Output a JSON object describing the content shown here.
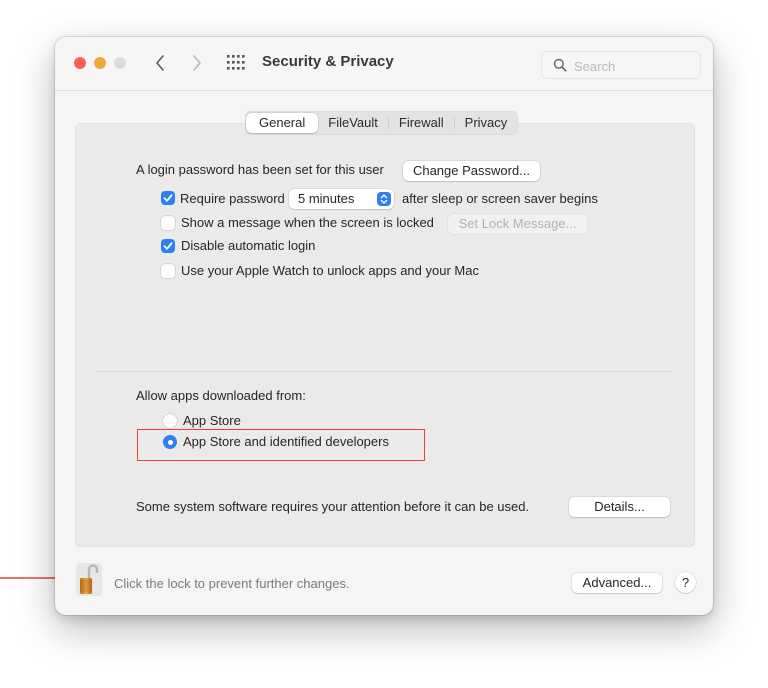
{
  "window": {
    "title": "Security & Privacy",
    "search_placeholder": "Search",
    "traffic_lights": {
      "close": "#fe5f57",
      "minimize": "#f0a93b",
      "maximize": "#dcdbda"
    }
  },
  "tabs": [
    {
      "label": "General",
      "active": true
    },
    {
      "label": "FileVault",
      "active": false
    },
    {
      "label": "Firewall",
      "active": false
    },
    {
      "label": "Privacy",
      "active": false
    }
  ],
  "general": {
    "login_password_text": "A login password has been set for this user",
    "change_password_label": "Change Password...",
    "require_password": {
      "label": "Require password",
      "checked": true,
      "select_value": "5 minutes",
      "suffix": "after sleep or screen saver begins"
    },
    "show_message": {
      "label": "Show a message when the screen is locked",
      "checked": false,
      "button_label": "Set Lock Message...",
      "button_enabled": false
    },
    "disable_auto_login": {
      "label": "Disable automatic login",
      "checked": true
    },
    "apple_watch": {
      "label": "Use your Apple Watch to unlock apps and your Mac",
      "checked": false
    }
  },
  "allow_apps": {
    "heading": "Allow apps downloaded from:",
    "options": [
      {
        "label": "App Store",
        "selected": false
      },
      {
        "label": "App Store and identified developers",
        "selected": true
      }
    ],
    "highlight_color": "#e8423f"
  },
  "system_software": {
    "text": "Some system software requires your attention before it can be used.",
    "details_label": "Details..."
  },
  "footer": {
    "lock_text": "Click the lock to prevent further changes.",
    "lock_state": "unlocked",
    "advanced_label": "Advanced...",
    "help_label": "?"
  },
  "accent_color": "#2f7ff5",
  "annotation_arrow_color": "#e8423f"
}
